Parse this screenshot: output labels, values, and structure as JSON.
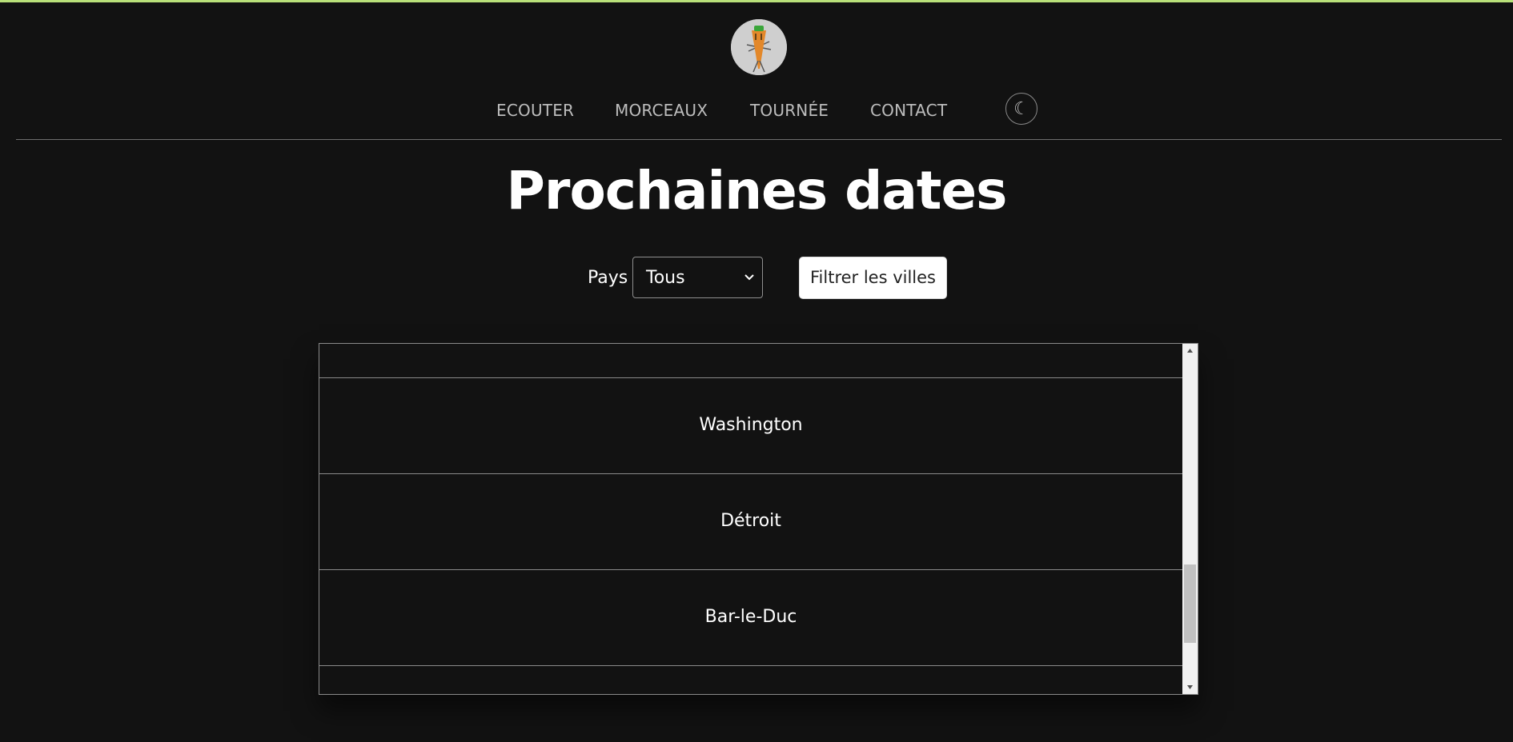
{
  "header": {
    "nav": [
      {
        "label": "ECOUTER"
      },
      {
        "label": "MORCEAUX"
      },
      {
        "label": "TOURNÉE"
      },
      {
        "label": "CONTACT"
      }
    ],
    "theme_toggle_icon": "moon-icon",
    "theme_toggle_glyph": "☾",
    "logo_icon": "carrot-logo-icon",
    "accent_color": "#b9e07a"
  },
  "main": {
    "title": "Prochaines dates",
    "filter": {
      "label": "Pays",
      "selected": "Tous",
      "button_label": "Filtrer les villes"
    },
    "cities": [
      {
        "name": ""
      },
      {
        "name": "Washington"
      },
      {
        "name": "Détroit"
      },
      {
        "name": "Bar-le-Duc"
      },
      {
        "name": ""
      }
    ]
  },
  "colors": {
    "background": "#121212",
    "text": "#ffffff",
    "nav_text": "#bdbdbd",
    "border": "#8a8a8a"
  }
}
